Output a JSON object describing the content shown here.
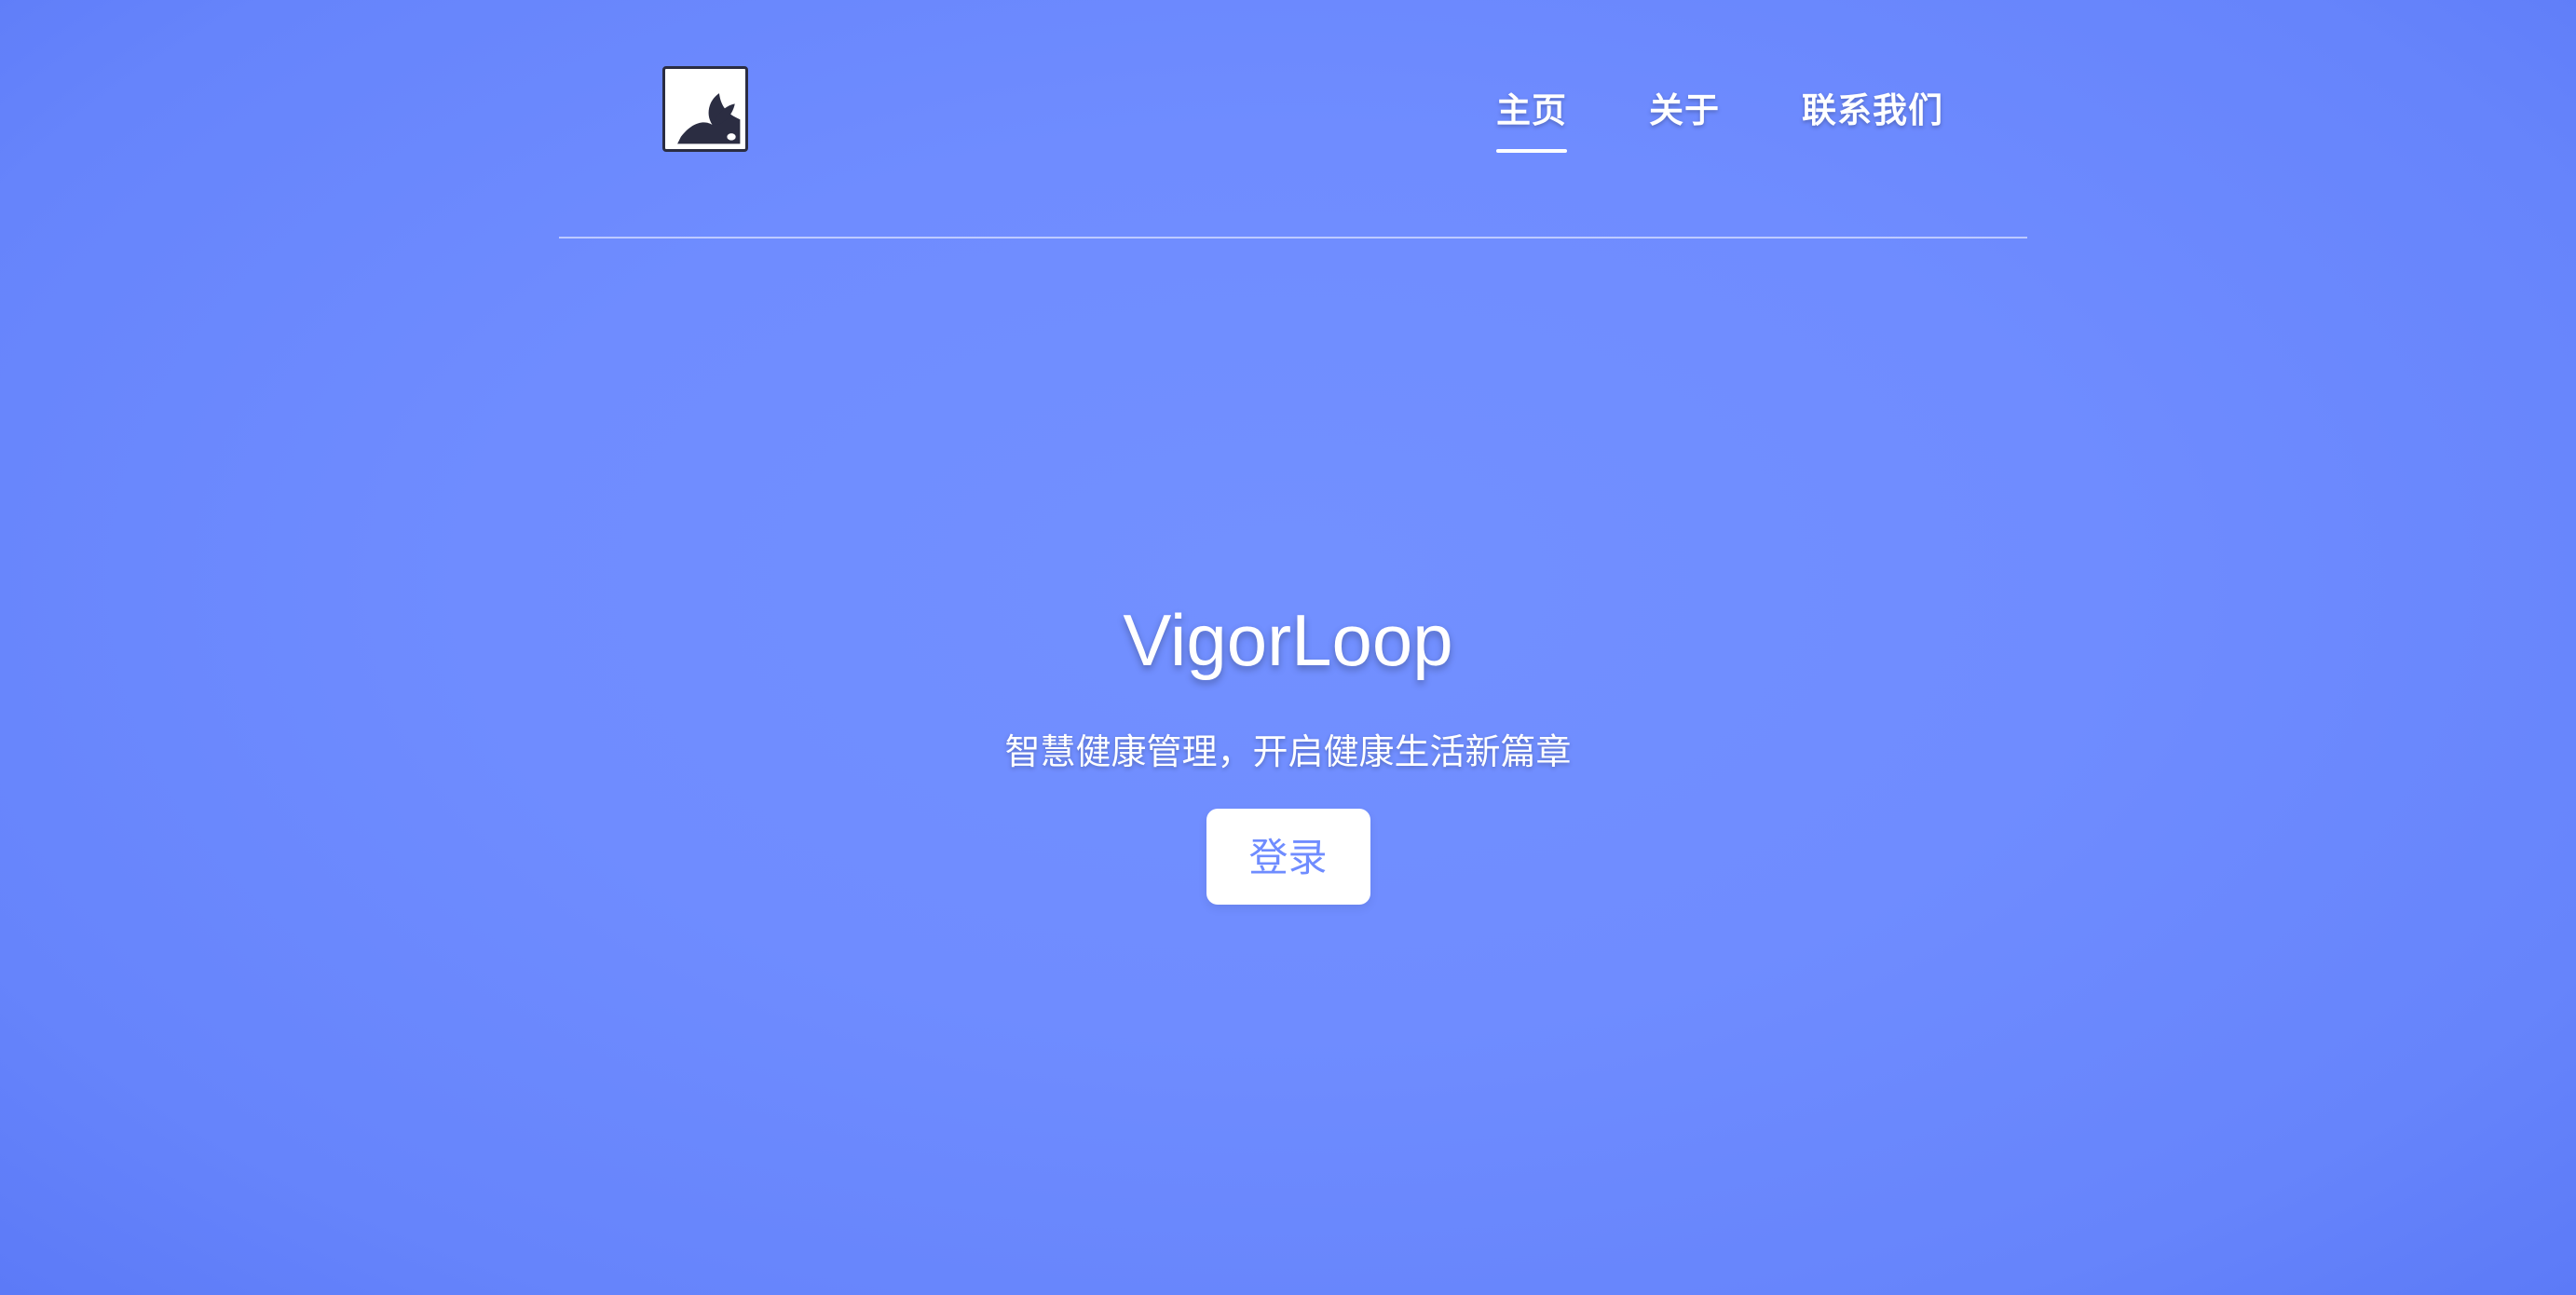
{
  "header": {
    "logo_icon": "dark-leaf-logo-icon",
    "nav": [
      {
        "label": "主页",
        "active": true
      },
      {
        "label": "关于",
        "active": false
      },
      {
        "label": "联系我们",
        "active": false
      }
    ]
  },
  "hero": {
    "title": "VigorLoop",
    "subtitle": "智慧健康管理，开启健康生活新篇章",
    "login_label": "登录"
  },
  "colors": {
    "background": "#6f8cff",
    "text": "#ffffff",
    "button_text": "#6f8cff",
    "logo_dark": "#2b2d42"
  }
}
